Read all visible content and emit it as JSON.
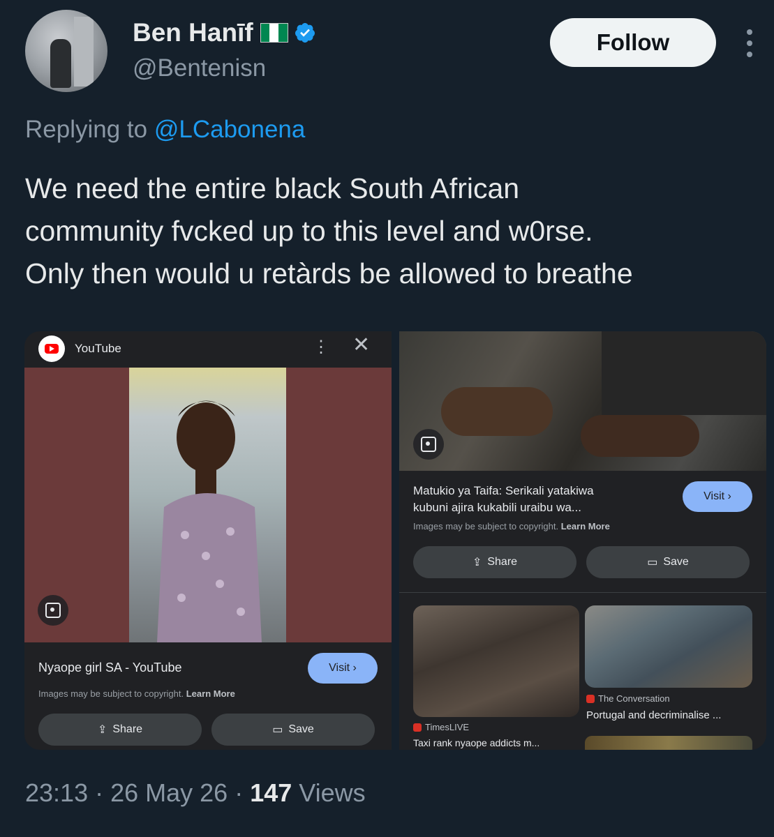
{
  "header": {
    "display_name": "Ben Hanīf",
    "handle": "@Bentenisn",
    "follow_label": "Follow",
    "flag_colors": [
      "#008751",
      "#ffffff",
      "#008751"
    ],
    "verified_color": "#1d9bf0"
  },
  "reply": {
    "prefix": "Replying to ",
    "mention": "@LCabonena"
  },
  "tweet": {
    "lines": [
      "We need the entire black South African",
      "community fvcked up to this level and w0rse.",
      "Only then would u retàrds be allowed to breathe"
    ]
  },
  "media_left": {
    "source": "YouTube",
    "caption": "Nyaope girl SA - YouTube",
    "visit_label": "Visit ›",
    "copyright_text": "Images may be subject to copyright.",
    "learn_more": "Learn More",
    "share_label": "Share",
    "save_label": "Save"
  },
  "media_right": {
    "caption_line1": "Matukio ya Taifa: Serikali yatakiwa",
    "caption_line2": "kubuni ajira kukabili uraibu wa...",
    "visit_label": "Visit ›",
    "copyright_text": "Images may be subject to copyright.",
    "learn_more": "Learn More",
    "share_label": "Share",
    "save_label": "Save",
    "related": [
      {
        "source": "TimesLIVE",
        "title": "Taxi rank nyaope addicts m...",
        "source_color": "#d93025"
      },
      {
        "source": "The Conversation",
        "title": "Portugal and decriminalise ...",
        "source_color": "#d93025"
      }
    ]
  },
  "footer": {
    "time": "23:13",
    "separator": " · ",
    "date": "26 May 26",
    "views_count": "147",
    "views_label": " Views"
  }
}
